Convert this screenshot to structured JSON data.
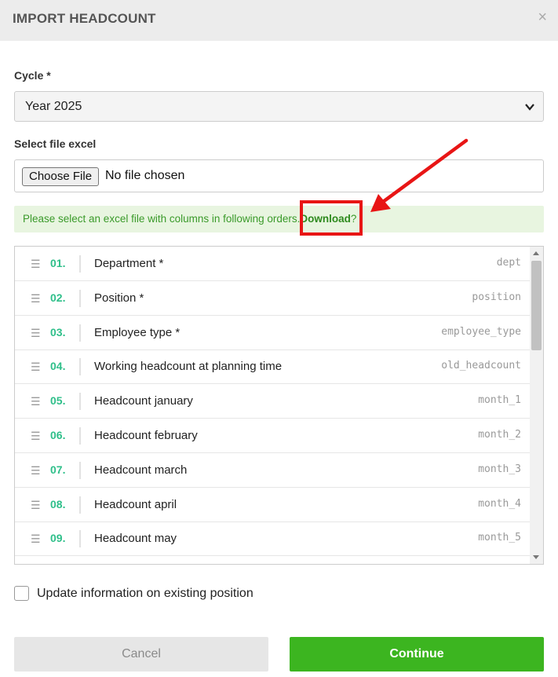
{
  "dialog": {
    "title": "IMPORT HEADCOUNT",
    "close_icon": "×"
  },
  "cycle": {
    "label": "Cycle *",
    "selected": "Year 2025"
  },
  "file": {
    "label": "Select file excel",
    "button_label": "Choose File",
    "status": "No file chosen"
  },
  "notice": {
    "message": "Please select an excel file with columns in following orders.",
    "link_label": "Download",
    "suffix": "?"
  },
  "columns": [
    {
      "num": "01.",
      "name": "Department *",
      "key": "dept"
    },
    {
      "num": "02.",
      "name": "Position *",
      "key": "position"
    },
    {
      "num": "03.",
      "name": "Employee type *",
      "key": "employee_type"
    },
    {
      "num": "04.",
      "name": "Working headcount at planning time",
      "key": "old_headcount"
    },
    {
      "num": "05.",
      "name": "Headcount january",
      "key": "month_1"
    },
    {
      "num": "06.",
      "name": "Headcount february",
      "key": "month_2"
    },
    {
      "num": "07.",
      "name": "Headcount march",
      "key": "month_3"
    },
    {
      "num": "08.",
      "name": "Headcount april",
      "key": "month_4"
    },
    {
      "num": "09.",
      "name": "Headcount may",
      "key": "month_5"
    }
  ],
  "update_existing": {
    "label": "Update information on existing position",
    "checked": false
  },
  "actions": {
    "cancel_label": "Cancel",
    "continue_label": "Continue"
  },
  "colors": {
    "accent_green": "#3cb520",
    "number_green": "#2fbf8a",
    "notice_bg": "#e8f5e0",
    "highlight_red": "#e81515"
  }
}
